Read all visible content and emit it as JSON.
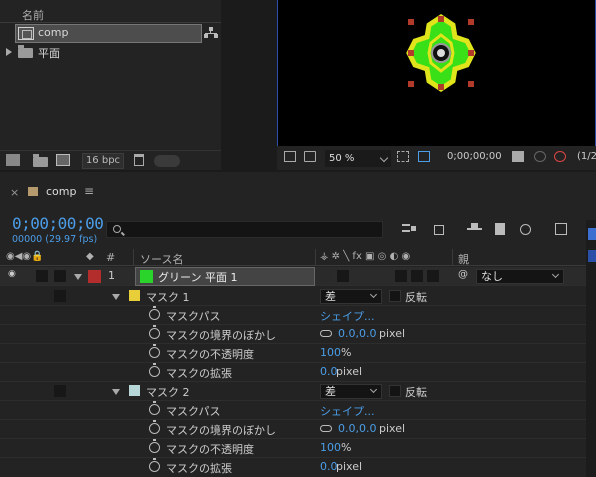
{
  "project": {
    "header_name": "名前",
    "items": [
      {
        "label": "comp",
        "icon": "composition-icon",
        "selected": true
      },
      {
        "label": "平面",
        "icon": "folder-icon",
        "selected": false
      }
    ],
    "bpc": "16 bpc"
  },
  "viewer": {
    "zoom": "50 %",
    "timecode": "0;00;00;00",
    "resolution": "(1/2"
  },
  "timeline": {
    "tab_close": "×",
    "tab_name": "comp",
    "tab_menu": "≡",
    "timecode": "0;00;00;00",
    "frames_fps": "00000 (29.97 fps)",
    "col_number": "#",
    "col_source": "ソース名",
    "col_parent": "親",
    "layer": {
      "number": "1",
      "name": "グリーン 平面 1",
      "label_color": "#b32d2d",
      "swatch_color": "#2bd42b",
      "parent": "なし"
    },
    "masks": [
      {
        "name": "マスク 1",
        "color": "#e8cf3a",
        "mode": "差",
        "invert_label": "反転",
        "props": [
          {
            "name": "マスクパス",
            "value": "シェイプ...",
            "unit": ""
          },
          {
            "name": "マスクの境界のぼかし",
            "value": "0.0,0.0",
            "unit": " pixel"
          },
          {
            "name": "マスクの不透明度",
            "value": "100",
            "unit": "%"
          },
          {
            "name": "マスクの拡張",
            "value": "0.0",
            "unit": " pixel"
          }
        ]
      },
      {
        "name": "マスク 2",
        "color": "#b6d6d8",
        "mode": "差",
        "invert_label": "反転",
        "props": [
          {
            "name": "マスクパス",
            "value": "シェイプ...",
            "unit": ""
          },
          {
            "name": "マスクの境界のぼかし",
            "value": "0.0,0.0",
            "unit": " pixel"
          },
          {
            "name": "マスクの不透明度",
            "value": "100",
            "unit": "%"
          },
          {
            "name": "マスクの拡張",
            "value": "0.0",
            "unit": " pixel"
          }
        ]
      }
    ]
  },
  "colors": {
    "accent_blue": "#4b9de7",
    "panel_bg": "#232323",
    "viewer_border": "#2a4fa7"
  }
}
